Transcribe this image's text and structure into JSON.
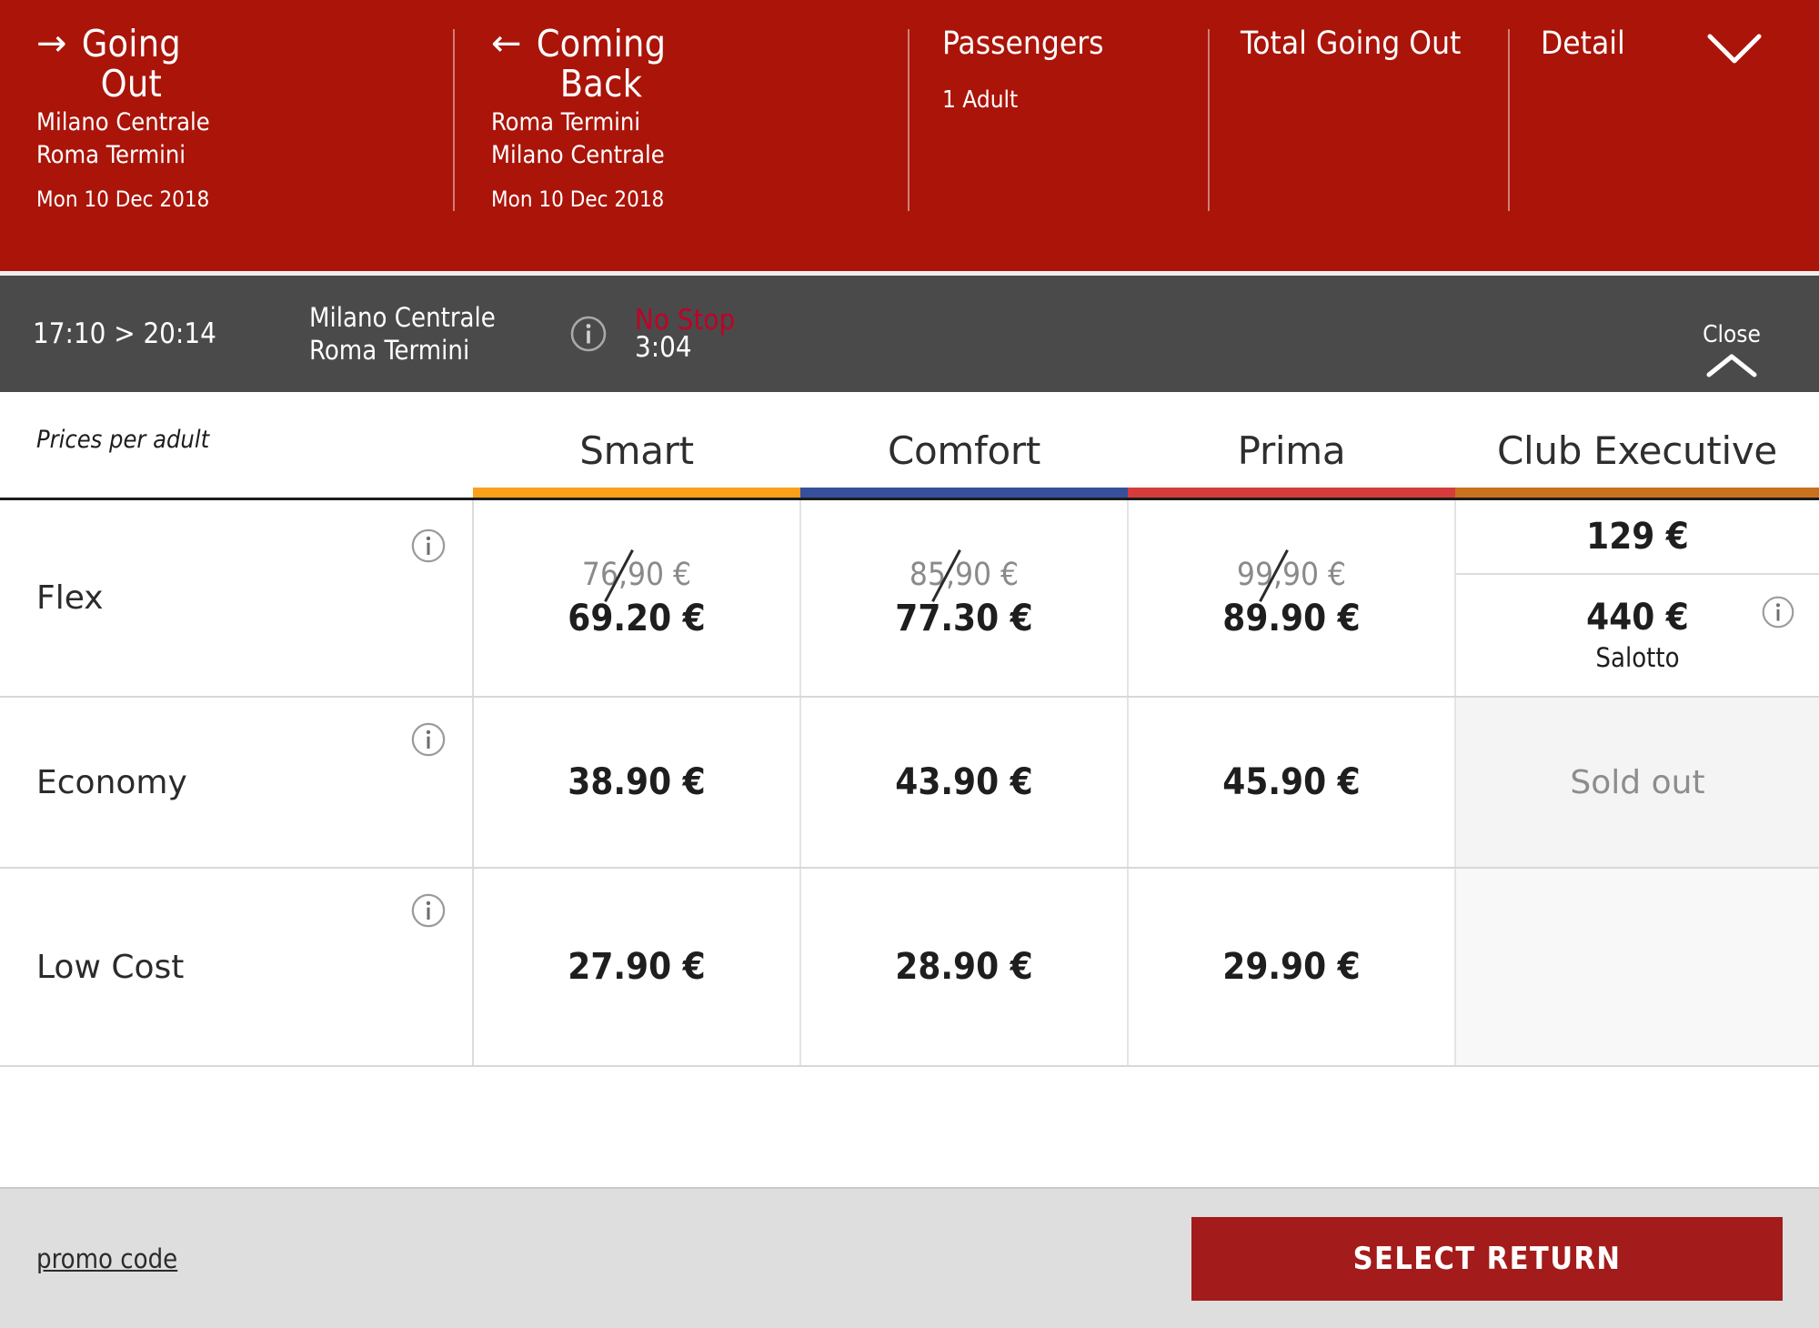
{
  "header": {
    "going_out": {
      "arrow": "→",
      "title_line1": "Going",
      "title_line2": "Out",
      "origin": "Milano Centrale",
      "destination": "Roma Termini",
      "date": "Mon 10 Dec 2018"
    },
    "coming_back": {
      "arrow": "←",
      "title_line1": "Coming",
      "title_line2": "Back",
      "origin": "Roma Termini",
      "destination": "Milano Centrale",
      "date": "Mon 10 Dec 2018"
    },
    "passengers": {
      "label": "Passengers",
      "value": "1 Adult"
    },
    "total_going_out": {
      "label": "Total Going Out",
      "value": ""
    },
    "detail": {
      "label": "Detail"
    },
    "brand_color": "#aa1409"
  },
  "train_bar": {
    "time_range": "17:10 > 20:14",
    "origin": "Milano Centrale",
    "destination": "Roma Termini",
    "stops": "No Stop",
    "duration": "3:04",
    "stops_color": "#c00028",
    "close_label": "Close",
    "background": "#4a4a4a"
  },
  "table": {
    "caption": "Prices per adult",
    "classes": [
      {
        "name": "Smart",
        "color": "#f9a11b"
      },
      {
        "name": "Comfort",
        "color": "#36509b"
      },
      {
        "name": "Prima",
        "color": "#d63c3c"
      },
      {
        "name": "Club Executive",
        "color": "#c8721e"
      }
    ],
    "rows": [
      {
        "name": "Flex",
        "cells": [
          {
            "type": "discount",
            "old": "76,90 €",
            "new": "69.20 €"
          },
          {
            "type": "discount",
            "old": "85,90 €",
            "new": "77.30 €"
          },
          {
            "type": "discount",
            "old": "99,90 €",
            "new": "89.90 €"
          },
          {
            "type": "split",
            "top": "129 €",
            "bottom": "440 €",
            "bottom_note": "Salotto"
          }
        ]
      },
      {
        "name": "Economy",
        "cells": [
          {
            "type": "price",
            "value": "38.90 €"
          },
          {
            "type": "price",
            "value": "43.90 €"
          },
          {
            "type": "price",
            "value": "45.90 €"
          },
          {
            "type": "soldout",
            "value": "Sold out"
          }
        ]
      },
      {
        "name": "Low Cost",
        "cells": [
          {
            "type": "price",
            "value": "27.90 €"
          },
          {
            "type": "price",
            "value": "28.90 €"
          },
          {
            "type": "price",
            "value": "29.90 €"
          },
          {
            "type": "empty",
            "value": ""
          }
        ]
      }
    ]
  },
  "footer": {
    "promo_label": "promo code",
    "select_label": "SELECT RETURN",
    "select_color": "#a41b1b"
  }
}
